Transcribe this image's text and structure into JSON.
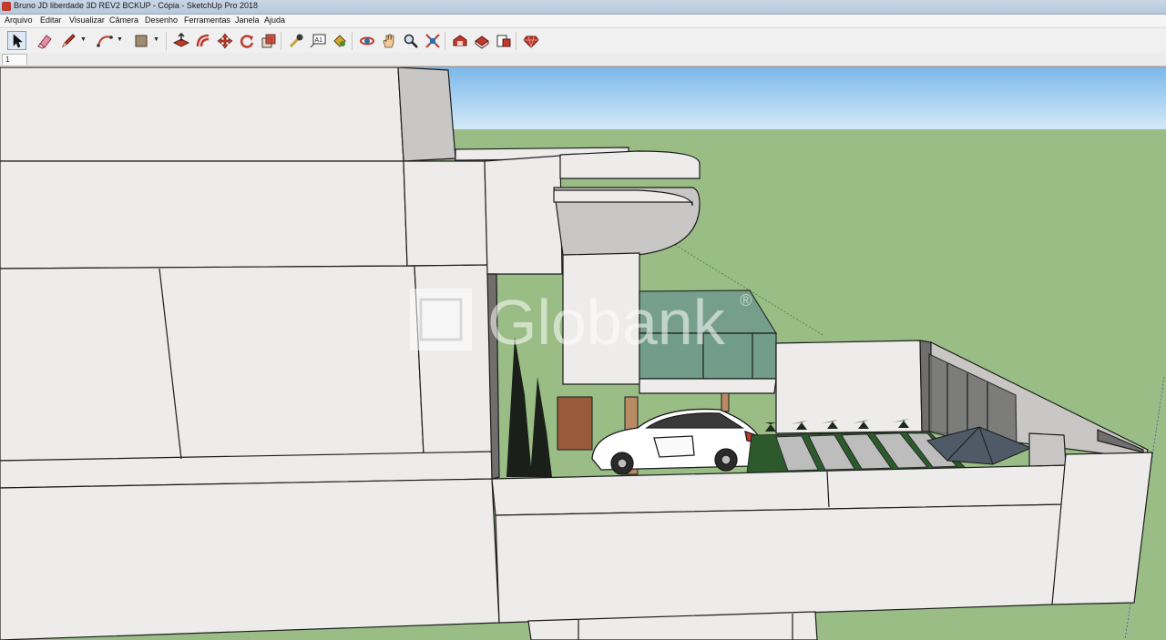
{
  "window": {
    "title": "Bruno JD liberdade 3D REV2 BCKUP - Cópia - SketchUp Pro 2018",
    "app_icon": "sketchup-icon"
  },
  "menu": {
    "items": [
      "Arquivo",
      "Editar",
      "Visualizar",
      "Câmera",
      "Desenho",
      "Ferramentas",
      "Janela",
      "Ajuda"
    ]
  },
  "toolbar": {
    "tools": [
      {
        "name": "select-tool",
        "icon": "arrow-cursor-icon",
        "active": true
      },
      {
        "name": "eraser-tool",
        "icon": "eraser-icon"
      },
      {
        "name": "line-tool",
        "icon": "pencil-icon",
        "dropdown": true
      },
      {
        "name": "arc-tool",
        "icon": "arc-icon",
        "dropdown": true
      },
      {
        "name": "rectangle-tool",
        "icon": "rectangle-icon",
        "dropdown": true
      },
      {
        "name": "push-pull-tool",
        "icon": "push-pull-icon"
      },
      {
        "name": "offset-tool",
        "icon": "offset-icon"
      },
      {
        "name": "move-tool",
        "icon": "move-icon"
      },
      {
        "name": "rotate-tool",
        "icon": "rotate-icon"
      },
      {
        "name": "scale-tool",
        "icon": "scale-icon"
      },
      {
        "name": "tape-measure-tool",
        "icon": "tape-measure-icon"
      },
      {
        "name": "text-tool",
        "icon": "text-icon"
      },
      {
        "name": "paint-bucket-tool",
        "icon": "paint-bucket-icon"
      },
      {
        "name": "orbit-tool",
        "icon": "orbit-icon"
      },
      {
        "name": "pan-tool",
        "icon": "hand-icon"
      },
      {
        "name": "zoom-tool",
        "icon": "magnifier-icon"
      },
      {
        "name": "zoom-extents-tool",
        "icon": "zoom-extents-icon"
      },
      {
        "name": "3d-warehouse",
        "icon": "warehouse-icon"
      },
      {
        "name": "extension-warehouse",
        "icon": "extension-warehouse-icon"
      },
      {
        "name": "layout-send",
        "icon": "layout-icon"
      },
      {
        "name": "extension-manager",
        "icon": "ruby-gem-icon"
      }
    ],
    "text_tool_glyph": "A1"
  },
  "scenes": {
    "tabs": [
      "1"
    ]
  },
  "viewport": {
    "watermark": "Globank",
    "watermark_mark": "®",
    "colors": {
      "sky_top": "#7cb8ea",
      "sky_bottom": "#d6ebf8",
      "ground": "#99bd85",
      "wall": "#eeeceb",
      "wall_shadow": "#c9c7c6",
      "dark_wall": "#6f6f6f",
      "glass": "#6f9a8c",
      "brick": "#9a5b3d",
      "wood": "#b98a63",
      "edge": "#1c1c1c"
    }
  }
}
